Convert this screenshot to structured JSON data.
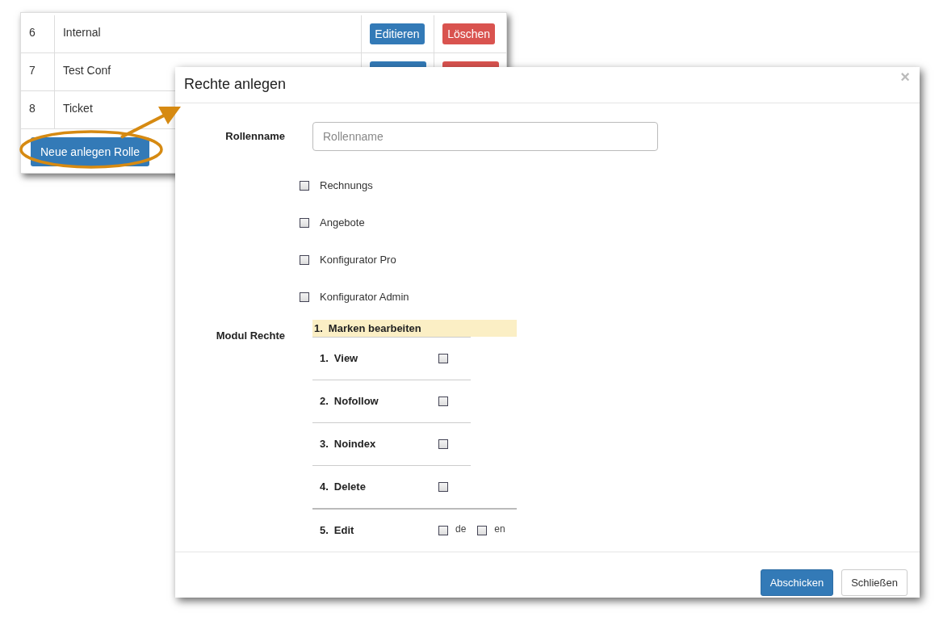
{
  "roles_table": {
    "rows": [
      {
        "number": "6",
        "name": "Internal",
        "kind": "labeled",
        "edit_label": "Editieren",
        "delete_label": "Löschen"
      },
      {
        "number": "7",
        "name": "Test Conf",
        "kind": "clipped"
      },
      {
        "number": "8",
        "name": "Ticket",
        "kind": "hidden"
      }
    ],
    "new_button": "Neue anlegen Rolle"
  },
  "modal": {
    "title": "Rechte anlegen",
    "close": "×",
    "role_field": {
      "label": "Rollenname",
      "placeholder": "Rollenname"
    },
    "options": [
      {
        "label": "Rechnungs",
        "checked": false
      },
      {
        "label": "Angebote",
        "checked": false
      },
      {
        "label": "Konfigurator Pro",
        "checked": false
      },
      {
        "label": "Konfigurator Admin",
        "checked": false
      }
    ],
    "module_rights": {
      "label": "Modul Rechte",
      "modules": [
        {
          "number": "1.",
          "title": "Marken bearbeiten",
          "permissions": [
            {
              "number": "1.",
              "label": "View",
              "options": [
                {
                  "checked": false
                }
              ]
            },
            {
              "number": "2.",
              "label": "Nofollow",
              "options": [
                {
                  "checked": false
                }
              ]
            },
            {
              "number": "3.",
              "label": "Noindex",
              "options": [
                {
                  "checked": false
                }
              ]
            },
            {
              "number": "4.",
              "label": "Delete",
              "options": [
                {
                  "checked": false
                }
              ]
            },
            {
              "number": "5.",
              "label": "Edit",
              "options": [
                {
                  "label": "de",
                  "checked": false
                },
                {
                  "label": "en",
                  "checked": false
                }
              ]
            }
          ]
        }
      ]
    },
    "buttons": [
      {
        "label": "Abschicken",
        "kind": "primary"
      },
      {
        "label": "Schließen",
        "kind": "default"
      }
    ]
  }
}
